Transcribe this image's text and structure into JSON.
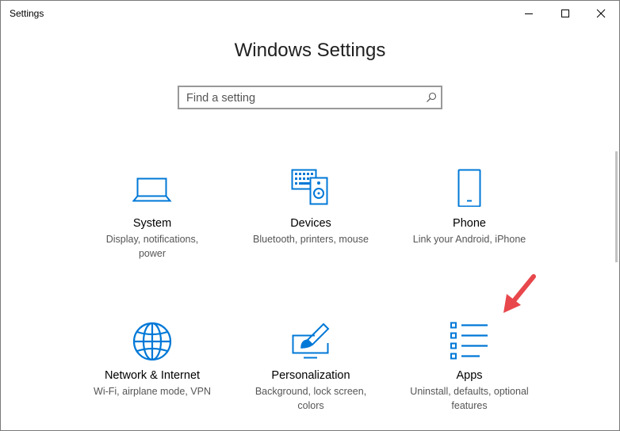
{
  "window": {
    "title": "Settings"
  },
  "header": {
    "title": "Windows Settings"
  },
  "search": {
    "placeholder": "Find a setting",
    "value": ""
  },
  "tiles": [
    {
      "title": "System",
      "desc_line1": "Display, notifications,",
      "desc_line2": "power",
      "icon": "laptop-icon"
    },
    {
      "title": "Devices",
      "desc_line1": "Bluetooth, printers, mouse",
      "desc_line2": "",
      "icon": "keyboard-speaker-icon"
    },
    {
      "title": "Phone",
      "desc_line1": "Link your Android, iPhone",
      "desc_line2": "",
      "icon": "phone-icon"
    },
    {
      "title": "Network & Internet",
      "desc_line1": "Wi-Fi, airplane mode, VPN",
      "desc_line2": "",
      "icon": "globe-icon"
    },
    {
      "title": "Personalization",
      "desc_line1": "Background, lock screen,",
      "desc_line2": "colors",
      "icon": "paintbrush-icon"
    },
    {
      "title": "Apps",
      "desc_line1": "Uninstall, defaults, optional",
      "desc_line2": "features",
      "icon": "apps-list-icon"
    }
  ],
  "colors": {
    "accent": "#0078d7",
    "annotation_arrow": "#e8474c"
  }
}
